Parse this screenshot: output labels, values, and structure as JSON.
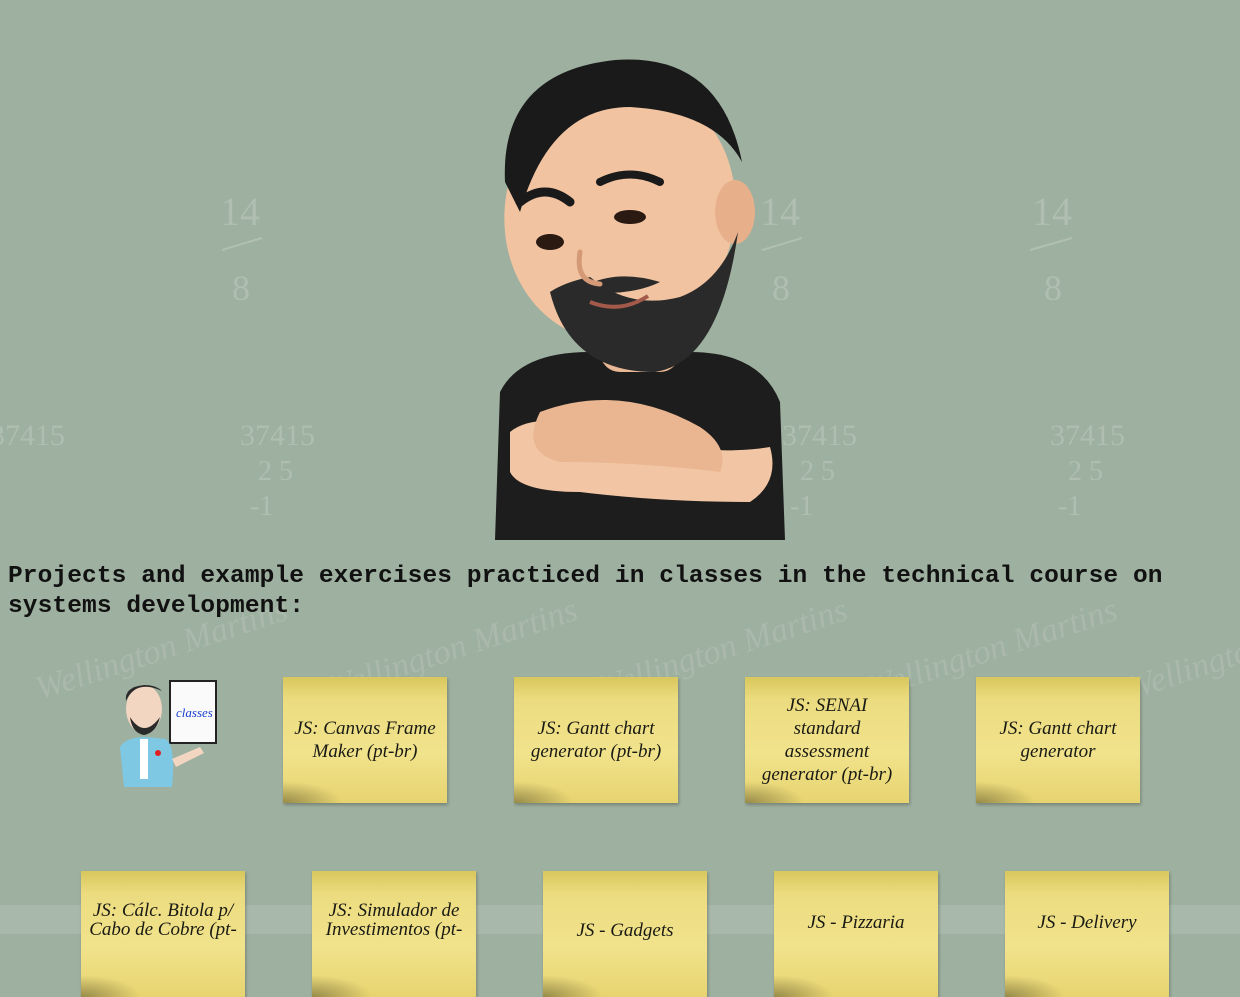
{
  "heading": "Projects and example exercises practiced in classes in the technical course on systems development:",
  "background": {
    "color": "#9eb0a0",
    "chalk_marks": [
      "14",
      "8",
      "37415",
      "2 5",
      "-1",
      "Wellington Martins"
    ]
  },
  "avatar": {
    "description_icon": "bearded-man-avatar-icon"
  },
  "thumbnail": {
    "icon": "teacher-classes-logo-icon",
    "board_text": "classes"
  },
  "notes_row1": [
    "JS: Canvas Frame Maker (pt-br)",
    "JS: Gantt chart generator (pt-br)",
    "JS: SENAI standard assessment generator (pt-br)",
    "JS: Gantt chart generator"
  ],
  "notes_row2": [
    "JS: Cálc. Bitola p/ Cabo de Cobre (pt-",
    "JS: Simulador de Investimentos (pt-",
    "JS - Gadgets",
    "JS - Pizzaria",
    "JS - Delivery"
  ],
  "colors": {
    "note": "#f1e38c",
    "text": "#111111"
  }
}
